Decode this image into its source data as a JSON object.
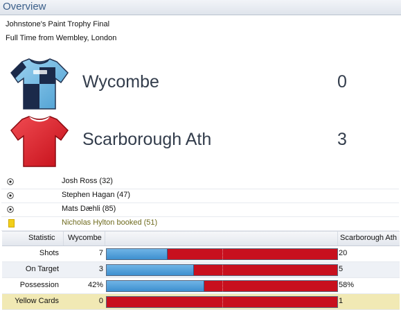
{
  "panel": {
    "title": "Overview"
  },
  "match": {
    "competition": "Johnstone's Paint Trophy Final",
    "status": "Full Time from Wembley, London"
  },
  "teams": [
    {
      "name": "Wycombe",
      "score": "0",
      "shirt_colors": [
        "#7ec3e8",
        "#1b2a4a"
      ]
    },
    {
      "name": "Scarborough Ath",
      "score": "3",
      "shirt_colors": [
        "#d9151f",
        "#ffffff"
      ]
    }
  ],
  "events": [
    {
      "icon": "goal-ball-icon",
      "text": "Josh Ross (32)"
    },
    {
      "icon": "goal-ball-icon",
      "text": "Stephen Hagan (47)"
    },
    {
      "icon": "goal-ball-icon",
      "text": "Mats Dæhli (85)"
    },
    {
      "icon": "yellow-card-icon",
      "text": "Nicholas Hylton booked (51)"
    }
  ],
  "stats": {
    "headers": {
      "statistic": "Statistic",
      "home": "Wycombe",
      "away": "Scarborough Ath"
    },
    "rows": [
      {
        "label": "Shots",
        "home": "7",
        "away": "20",
        "home_share": 0.26
      },
      {
        "label": "On Target",
        "home": "3",
        "away": "5",
        "home_share": 0.375
      },
      {
        "label": "Possession",
        "home": "42%",
        "away": "58%",
        "home_share": 0.42
      },
      {
        "label": "Yellow Cards",
        "home": "0",
        "away": "1",
        "home_share": 0.0
      }
    ]
  },
  "colors": {
    "home_bar": "#4a9bd8",
    "away_bar": "#c8101e",
    "highlight_row": "#f1e9b4"
  }
}
